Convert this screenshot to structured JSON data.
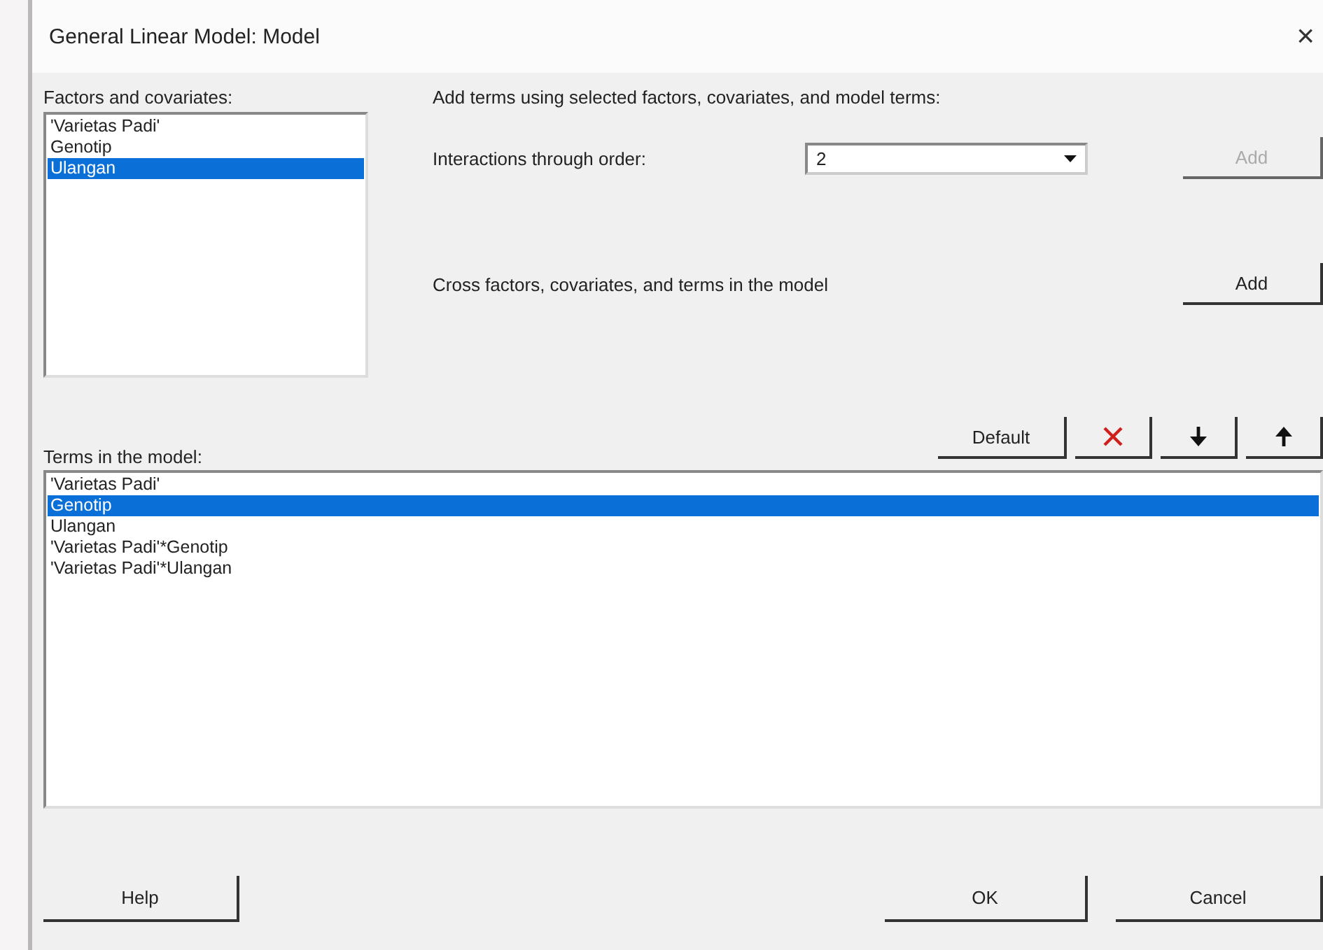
{
  "window": {
    "title": "General Linear Model: Model",
    "close": "×"
  },
  "factors": {
    "label": "Factors and covariates:",
    "items": [
      {
        "text": "'Varietas Padi'",
        "selected": false
      },
      {
        "text": "Genotip",
        "selected": false
      },
      {
        "text": "Ulangan",
        "selected": true
      }
    ]
  },
  "add_terms_heading": "Add terms using selected factors, covariates, and model terms:",
  "interactions": {
    "label": "Interactions through order:",
    "value": "2",
    "button": {
      "label": "Add",
      "disabled": true
    }
  },
  "cross": {
    "label": "Cross factors, covariates, and terms in the model",
    "button": {
      "label": "Add",
      "disabled": false
    }
  },
  "toolbar": [
    {
      "kind": "text",
      "label": "Default"
    },
    {
      "kind": "delete"
    },
    {
      "kind": "down"
    },
    {
      "kind": "up"
    }
  ],
  "terms": {
    "label": "Terms in the model:",
    "items": [
      {
        "text": "'Varietas Padi'",
        "selected": false
      },
      {
        "text": "Genotip",
        "selected": true
      },
      {
        "text": "Ulangan",
        "selected": false
      },
      {
        "text": "'Varietas Padi'*Genotip",
        "selected": false
      },
      {
        "text": "'Varietas Padi'*Ulangan",
        "selected": false
      }
    ]
  },
  "buttons": {
    "help": "Help",
    "ok": "OK",
    "cancel": "Cancel"
  }
}
